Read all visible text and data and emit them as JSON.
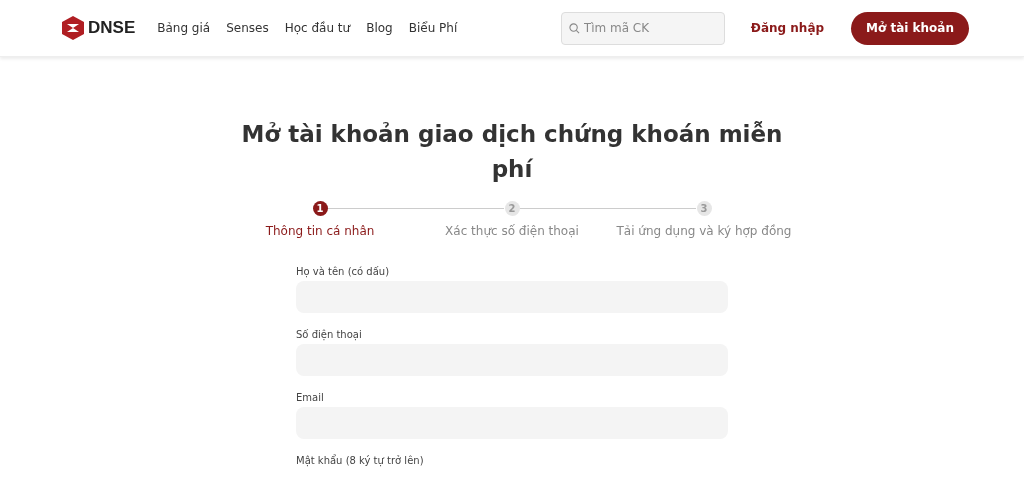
{
  "header": {
    "logo": "DNSE",
    "nav": [
      "Bảng giá",
      "Senses",
      "Học đầu tư",
      "Blog",
      "Biểu Phí"
    ],
    "search": {
      "placeholder": "Tìm mã CK"
    },
    "login": "Đăng nhập",
    "signup": "Mở tài khoản"
  },
  "title": "Mở tài khoản giao dịch chứng khoán miễn phí",
  "steps": [
    {
      "number": "1",
      "label": "Thông tin cá nhân",
      "selected": true
    },
    {
      "number": "2",
      "label": "Xác thực số điện thoại",
      "selected": false
    },
    {
      "number": "3",
      "label": "Tải ứng dụng và ký hợp đồng",
      "selected": false
    }
  ],
  "fields": [
    {
      "label": "Họ và tên (có dấu)"
    },
    {
      "label": "Số điện thoại"
    },
    {
      "label": "Email"
    },
    {
      "label": "Mật khẩu (8 ký tự trở lên)"
    }
  ]
}
